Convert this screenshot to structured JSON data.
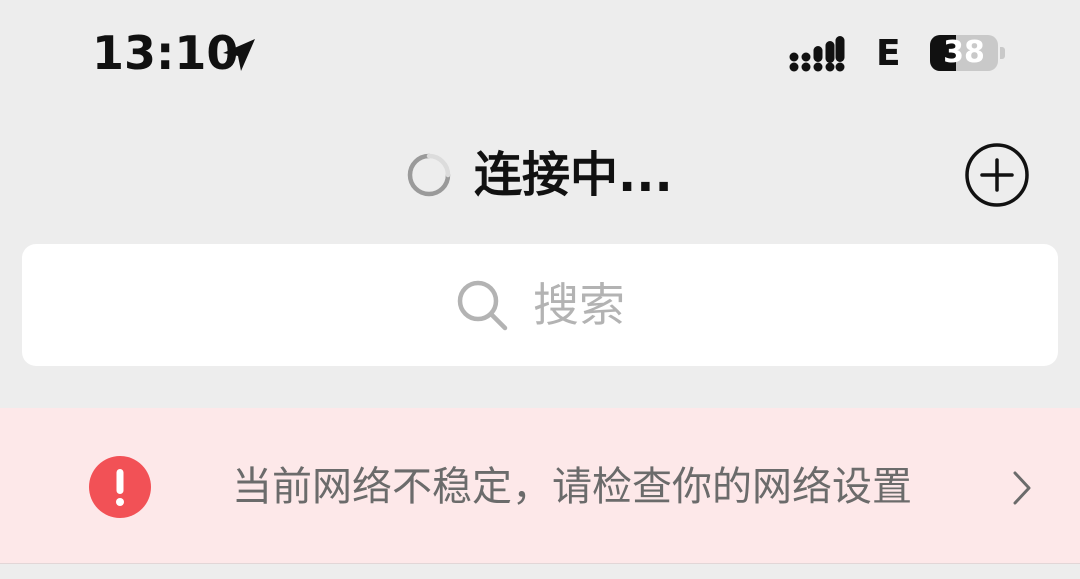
{
  "status_bar": {
    "time": "13:10",
    "network_type": "E",
    "battery_level": "38",
    "battery_fraction": 0.38,
    "icons": [
      "location-arrow-icon",
      "signal-icon",
      "battery-icon"
    ]
  },
  "header": {
    "title": "连接中...",
    "loading_icon": "spinner-icon",
    "add_icon": "plus-circle-icon"
  },
  "search": {
    "placeholder": "搜索",
    "icon": "search-icon"
  },
  "alert": {
    "message": "当前网络不稳定，请检查你的网络设置",
    "chevron": ">",
    "icon": "exclamation-circle-icon",
    "icon_color": "#f25156",
    "background_color": "#fde8e9"
  },
  "colors": {
    "page_background": "#ededed",
    "text_primary": "#111111",
    "text_placeholder": "#b3b3b3",
    "text_alert": "#6b6b6b"
  }
}
